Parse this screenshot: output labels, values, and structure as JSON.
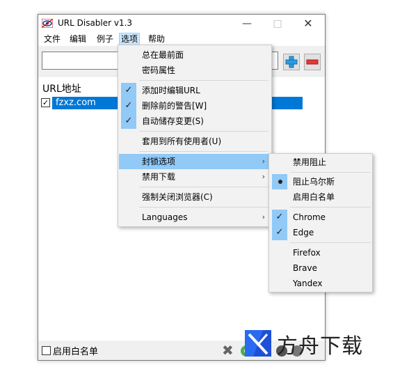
{
  "window": {
    "title": "URL Disabler v1.3",
    "min_glyph": "—",
    "max_glyph": "□",
    "close_glyph": "✕"
  },
  "menubar": {
    "items": [
      "文件",
      "编辑",
      "例子",
      "选项",
      "帮助"
    ],
    "active_index": 3
  },
  "toolbar": {
    "url_value": "",
    "add_icon": "plus-icon",
    "remove_icon": "minus-icon"
  },
  "list": {
    "header": "URL地址",
    "rows": [
      {
        "checked": true,
        "url": "fzxz.com",
        "selected": true
      }
    ]
  },
  "statusbar": {
    "whitelist_label": "启用白名单",
    "whitelist_checked": false,
    "clear_glyph": "✖"
  },
  "options_menu": {
    "items": [
      {
        "label": "总在最前面",
        "checked": false
      },
      {
        "label": "密码属性",
        "checked": false
      },
      {
        "label": "添加时编辑URL",
        "checked": true
      },
      {
        "label": "删除前的警告[W]",
        "checked": true
      },
      {
        "label": "自动储存变更(S)",
        "checked": true
      },
      {
        "label": "套用到所有使用者(U)",
        "checked": false
      },
      {
        "label": "封锁选项",
        "submenu": true,
        "highlighted": true
      },
      {
        "label": "禁用下载",
        "submenu": true
      },
      {
        "label": "强制关闭浏览器(C)",
        "checked": false
      },
      {
        "label": "Languages",
        "submenu": true
      }
    ]
  },
  "block_submenu": {
    "items": [
      {
        "label": "禁用阻止"
      },
      {
        "label": "阻止乌尔斯",
        "radio": true
      },
      {
        "label": "启用白名单"
      },
      {
        "label": "Chrome",
        "checked": true
      },
      {
        "label": "Edge",
        "checked": true
      },
      {
        "label": "Firefox"
      },
      {
        "label": "Brave"
      },
      {
        "label": "Yandex"
      }
    ]
  },
  "watermark": {
    "text": "方舟下载"
  }
}
